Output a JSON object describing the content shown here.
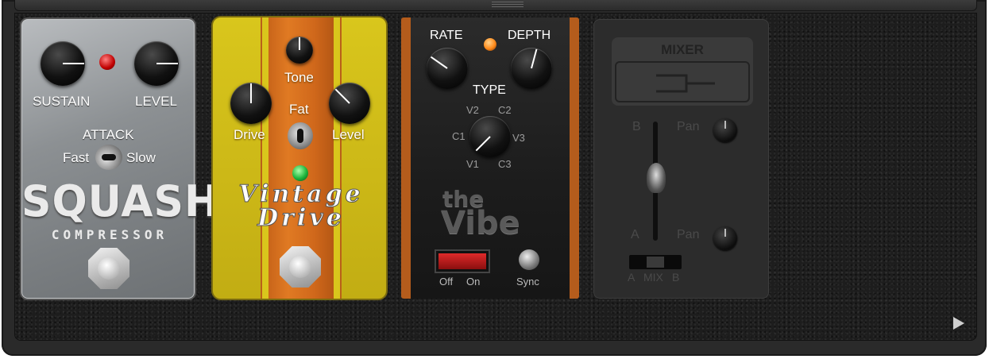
{
  "squash": {
    "sustain_label": "SUSTAIN",
    "level_label": "LEVEL",
    "attack_label": "ATTACK",
    "fast_label": "Fast",
    "slow_label": "Slow",
    "logo": "SQUASH",
    "sublogo": "COMPRESSOR",
    "led_color": "#e02020"
  },
  "vintage_drive": {
    "tone_label": "Tone",
    "fat_label": "Fat",
    "drive_label": "Drive",
    "level_label": "Level",
    "logo_line1": "Vintage",
    "logo_line2": "Drive",
    "led_color": "#22cc44"
  },
  "vibe": {
    "rate_label": "RATE",
    "depth_label": "DEPTH",
    "type_label": "TYPE",
    "type_options": [
      "V2",
      "C2",
      "C1",
      "V3",
      "V1",
      "C3"
    ],
    "logo_the": "the",
    "logo_vibe": "Vibe",
    "off_label": "Off",
    "on_label": "On",
    "sync_label": "Sync",
    "led_color": "#ff9922"
  },
  "mixer": {
    "title": "MIXER",
    "b_label": "B",
    "a_label": "A",
    "pan_label_top": "Pan",
    "pan_label_bottom": "Pan",
    "mix_a": "A",
    "mix_label": "MIX",
    "mix_b": "B"
  }
}
